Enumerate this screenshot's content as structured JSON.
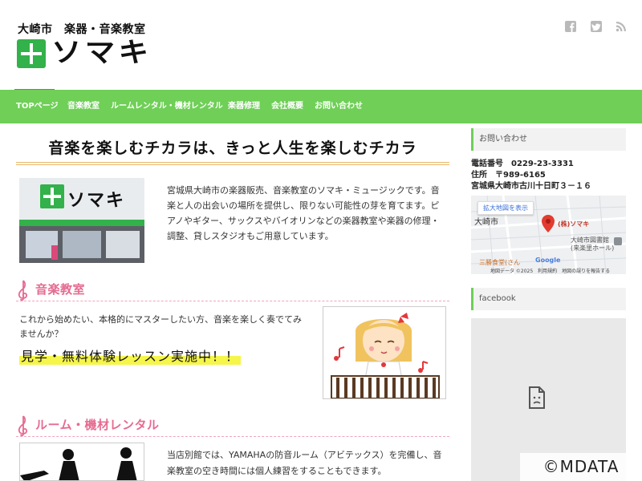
{
  "header": {
    "tagline": "大崎市　楽器・音楽教室",
    "logo_text": "ソマキ",
    "social_icons": [
      "facebook-icon",
      "twitter-icon",
      "rss-icon"
    ]
  },
  "nav": {
    "items": [
      {
        "label": "TOPページ"
      },
      {
        "label": "音楽教室"
      },
      {
        "label": "ルームレンタル・機材レンタル"
      },
      {
        "label": "楽器修理"
      },
      {
        "label": "会社概要"
      },
      {
        "label": "お問い合わせ"
      }
    ]
  },
  "main": {
    "title": "音楽を楽しむチカラは、きっと人生を楽しむチカラ",
    "store_sign": "ソマキ",
    "intro": "宮城県大崎市の楽器販売、音楽教室のソマキ・ミュージックです。音楽と人の出会いの場所を提供し、限りない可能性の芽を育てます。ピアノやギター、サックスやバイオリンなどの楽器教室や楽器の修理・調整、貸しスタジオもご用意しています。",
    "lesson": {
      "heading": "音楽教室",
      "text": "これから始めたい、本格的にマスターしたい方、音楽を楽しく奏でてみませんか？",
      "highlight": "見学・無料体験レッスン実施中！！"
    },
    "rental": {
      "heading": "ルーム・機材レンタル",
      "text": "当店別館では、YAMAHAの防音ルーム（アビテックス）を完備し、音楽教室の空き時間には個人練習をすることもできます。"
    }
  },
  "sidebar": {
    "contact_heading": "お問い合わせ",
    "phone": "電話番号　0229-23-3331",
    "postal": "住所　〒989-6165",
    "address": "宮城県大崎市古川十日町３－１６",
    "map": {
      "enlarge_button": "拡大地図を表示",
      "pin_label": "(株)ソマキ",
      "place_1": "大崎市図書館",
      "place_1b": "(来楽里ホール)",
      "place_2": "三勝食堂(さん",
      "place_3": "大崎市",
      "attribution": "地図データ ©2025　利用規約　地図の誤りを報告する",
      "brand": "Google"
    },
    "facebook_heading": "facebook",
    "facebook_icon": "broken-page-icon"
  },
  "watermark": "©MDATA"
}
